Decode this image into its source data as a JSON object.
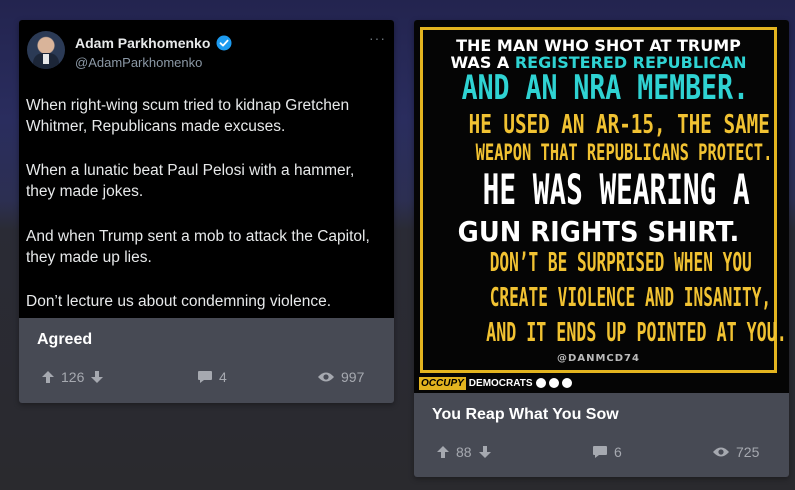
{
  "posts": [
    {
      "tweet": {
        "name": "Adam Parkhomenko",
        "handle": "@AdamParkhomenko",
        "paragraphs": [
          "When right-wing scum tried to kidnap Gretchen Whitmer, Republicans made excuses.",
          "When a lunatic beat Paul Pelosi with a hammer, they made jokes.",
          "And when Trump sent a mob to attack the Capitol, they made up lies.",
          "Don’t lecture us about condemning violence."
        ]
      },
      "title": "Agreed",
      "upvotes": "126",
      "comments": "4",
      "views": "997"
    },
    {
      "meme": {
        "line1": "THE MAN WHO SHOT AT TRUMP",
        "line2_a": "WAS A ",
        "line2_b": "REGISTERED REPUBLICAN",
        "line3": "AND AN NRA MEMBER.",
        "line4_a": "HE USED AN AR-15, ",
        "line4_b": "THE SAME",
        "line5": "WEAPON THAT REPUBLICANS PROTECT.",
        "line6": "HE WAS WEARING A",
        "line7": "GUN RIGHTS SHIRT.",
        "line8": "DON’T BE SURPRISED WHEN YOU",
        "line9": "CREATE VIOLENCE AND INSANITY,",
        "line10": "AND IT ENDS UP POINTED AT YOU.",
        "credit": "@DANMCD74",
        "brand_occupy": "OCCUPY",
        "brand_democrats": "DEMOCRATS"
      },
      "title": "You Reap What You Sow",
      "upvotes": "88",
      "comments": "6",
      "views": "725"
    }
  ],
  "colors": {
    "card_bg": "#474a54",
    "accent_yellow": "#f1c232",
    "accent_cyan": "#2fd3d3",
    "verified_blue": "#1d9bf0"
  },
  "icons": [
    "verified-badge-icon",
    "upvote-arrow-icon",
    "downvote-arrow-icon",
    "comment-bubble-icon",
    "eye-views-icon",
    "facebook-icon",
    "twitter-icon",
    "instagram-icon"
  ]
}
